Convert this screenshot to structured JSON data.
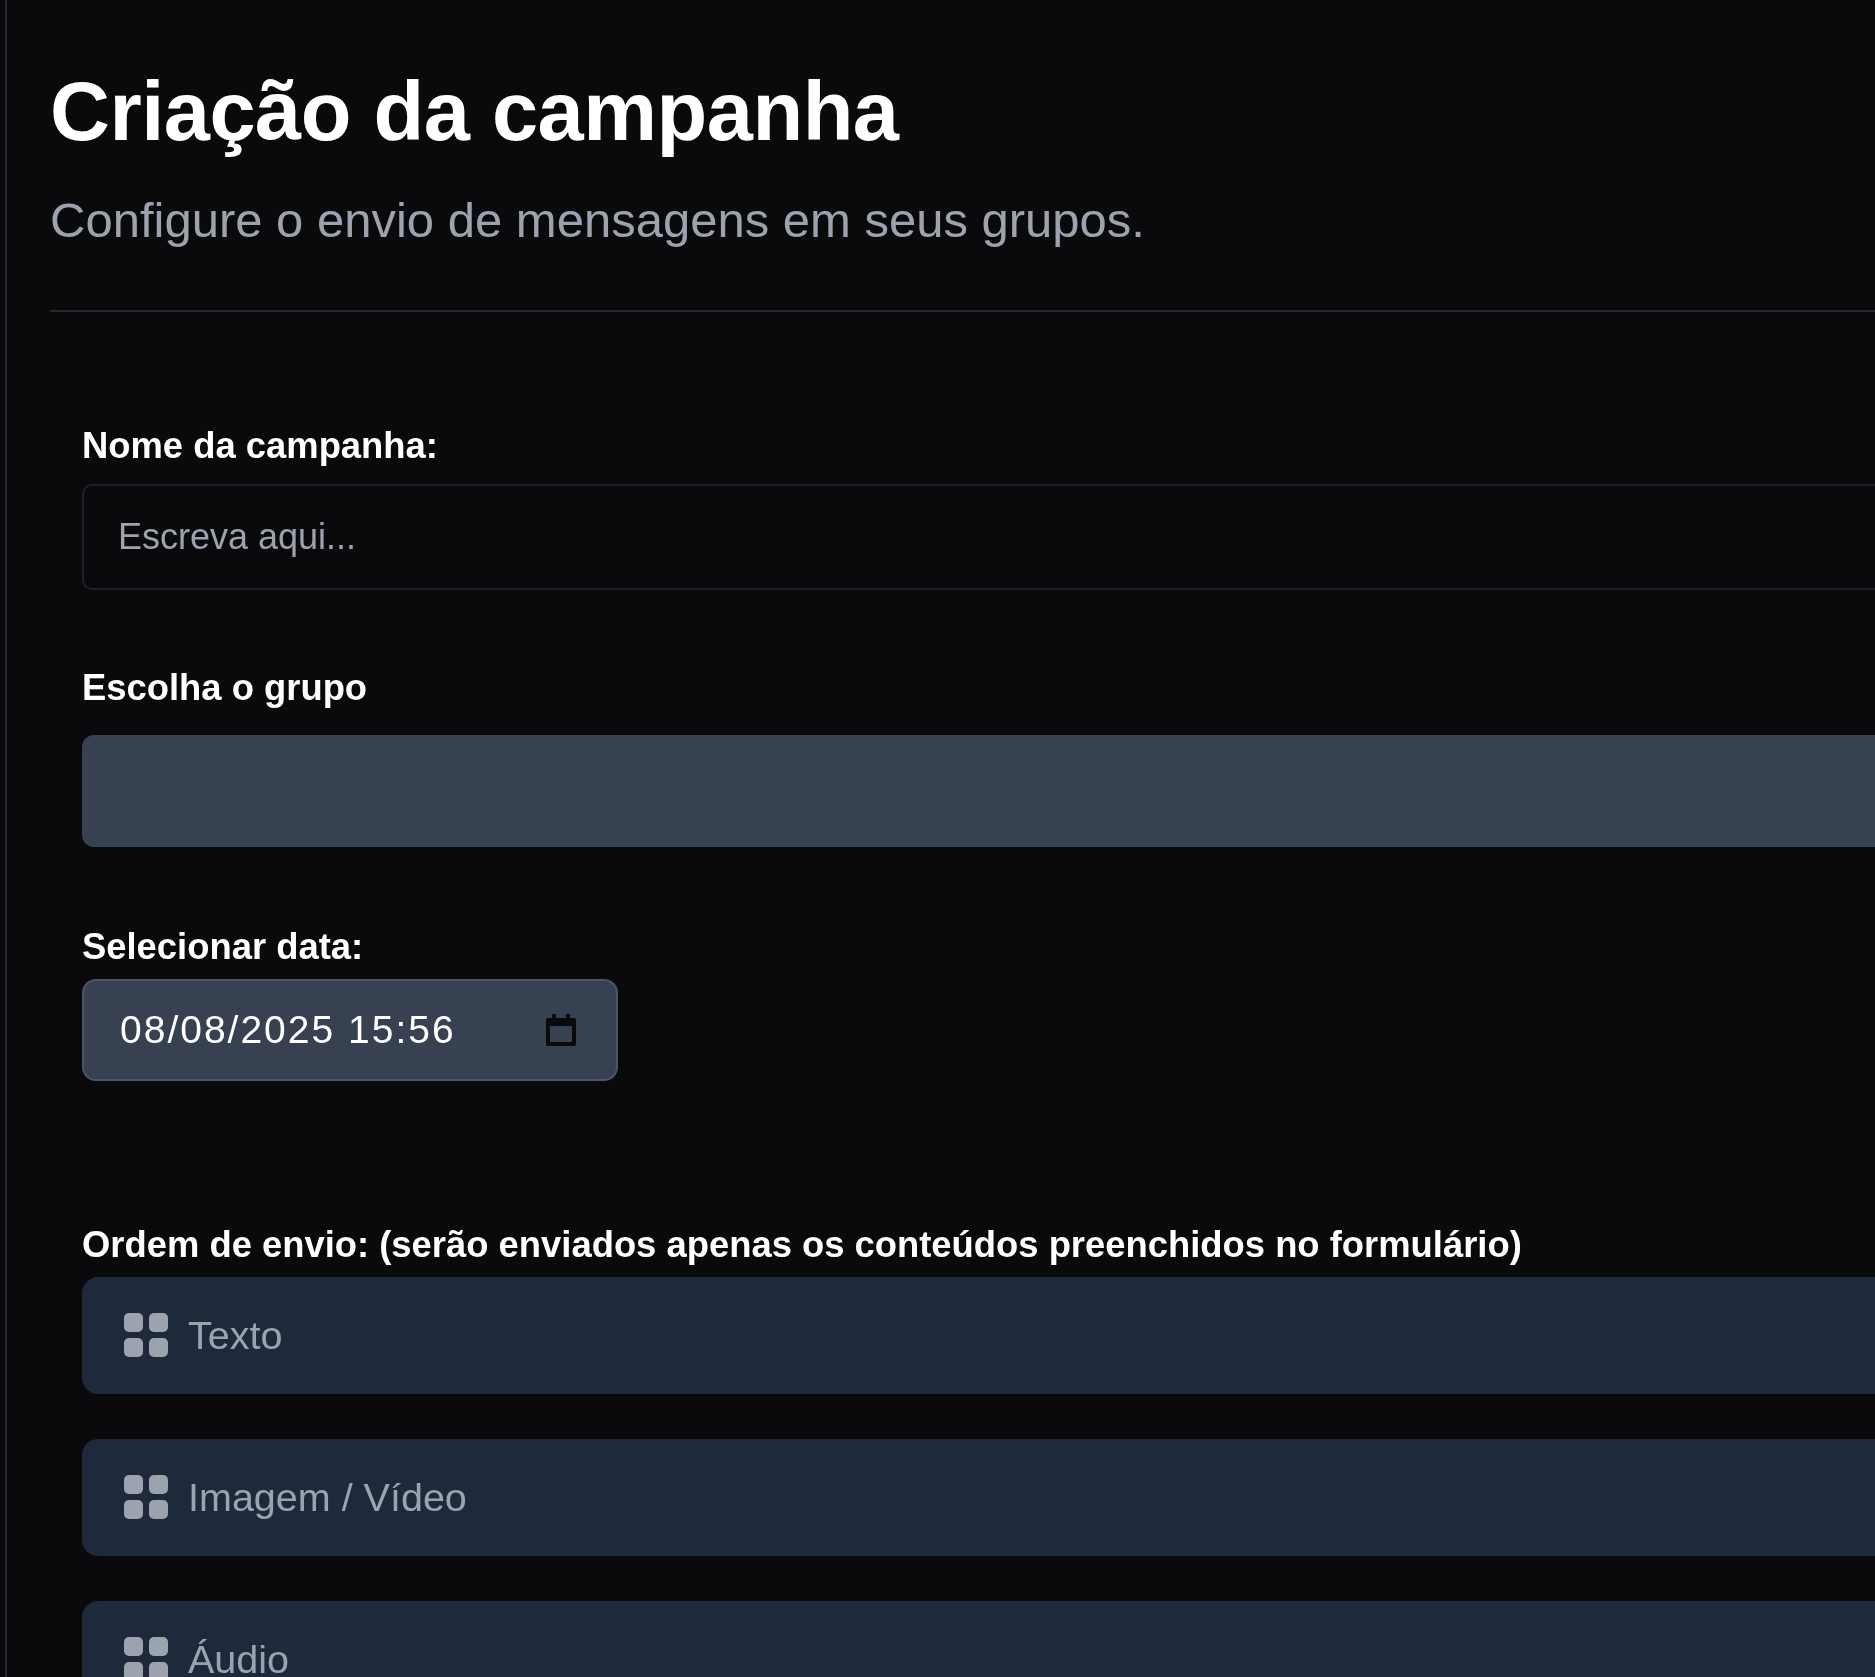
{
  "header": {
    "title": "Criação da campanha",
    "subtitle": "Configure o envio de mensagens em seus grupos."
  },
  "campaign_name": {
    "label": "Nome da campanha:",
    "placeholder": "Escreva aqui..."
  },
  "group": {
    "label": "Escolha o grupo"
  },
  "date": {
    "label": "Selecionar data:",
    "value": "08/08/2025 15:56"
  },
  "send_order": {
    "label": "Ordem de envio: (serão enviados apenas os conteúdos preenchidos no formulário)",
    "items": [
      {
        "label": "Texto"
      },
      {
        "label": "Imagem / Vídeo"
      },
      {
        "label": "Áudio"
      }
    ]
  }
}
